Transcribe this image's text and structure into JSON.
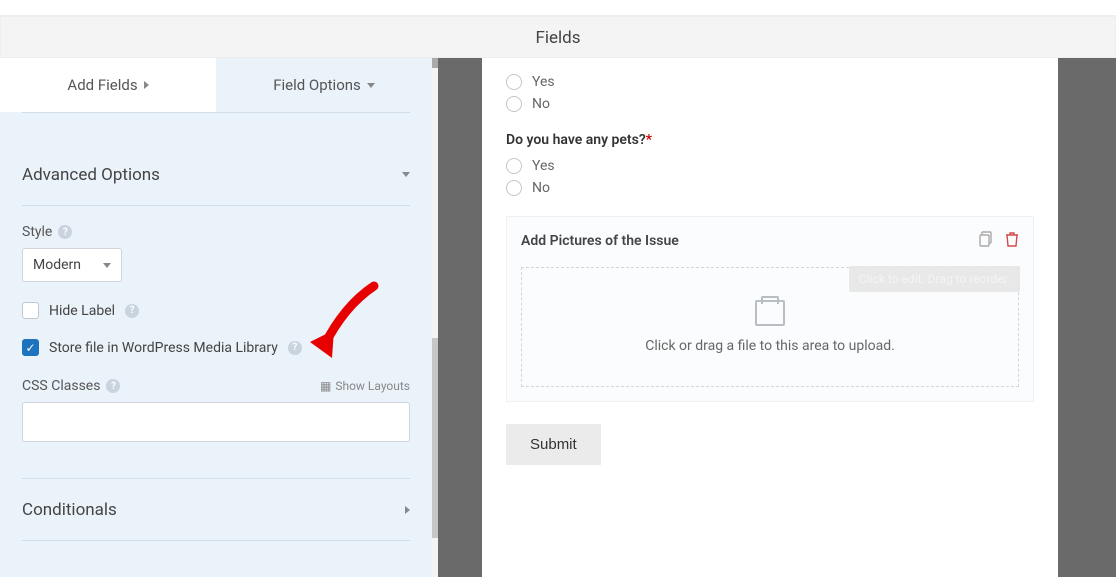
{
  "header": {
    "title": "Fields"
  },
  "tabs": {
    "add_fields": "Add Fields",
    "field_options": "Field Options"
  },
  "sidebar": {
    "advanced_label": "Advanced Options",
    "style_label": "Style",
    "style_value": "Modern",
    "hide_label": "Hide Label",
    "store_media": "Store file in WordPress Media Library",
    "css_classes": "CSS Classes",
    "show_layouts": "Show Layouts",
    "conditionals": "Conditionals"
  },
  "preview": {
    "opt_yes": "Yes",
    "opt_no": "No",
    "q_pets": "Do you have any pets?",
    "upload_title": "Add Pictures of the Issue",
    "drop_text": "Click or drag a file to this area to upload.",
    "tooltip": "Click to edit. Drag to reorder.",
    "submit": "Submit"
  }
}
